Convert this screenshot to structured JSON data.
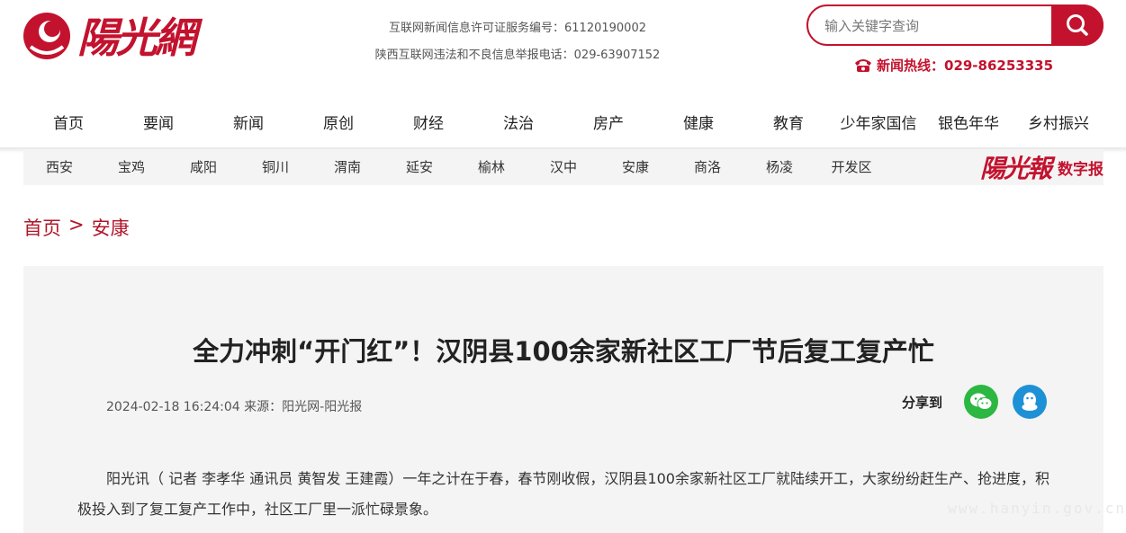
{
  "header": {
    "logo_text": "陽光網",
    "license_number": "互联网新闻信息许可证服务编号：61120190002",
    "report_phone": "陕西互联网违法和不良信息举报电话：029-63907152",
    "search_placeholder": "输入关键字查询",
    "hotline": "新闻热线：029-86253335"
  },
  "main_nav": [
    "首页",
    "要闻",
    "新闻",
    "原创",
    "财经",
    "法治",
    "房产",
    "健康",
    "教育",
    "少年家国信",
    "银色年华",
    "乡村振兴"
  ],
  "sub_nav": {
    "cities": [
      "西安",
      "宝鸡",
      "咸阳",
      "铜川",
      "渭南",
      "延安",
      "榆林",
      "汉中",
      "安康",
      "商洛",
      "杨凌",
      "开发区"
    ],
    "epaper_logo": "陽光報",
    "epaper_label": "数字报"
  },
  "breadcrumb": {
    "home": "首页",
    "separator": ">",
    "current": "安康"
  },
  "article": {
    "title": "全力冲刺“开门红”！汉阴县100余家新社区工厂节后复工复产忙",
    "datetime": "2024-02-18 16:24:04",
    "source": "来源：阳光网-阳光报",
    "share_label": "分享到",
    "body": "阳光讯（ 记者 李孝华 通讯员 黄智发 王建霞）一年之计在于春，春节刚收假，汉阴县100余家新社区工厂就陆续开工，大家纷纷赶生产、抢进度，积极投入到了复工复产工作中，社区工厂里一派忙碌景象。"
  },
  "watermark": "www.hanyin.gov.cn",
  "colors": {
    "brand_red": "#c3122e",
    "breadcrumb_red": "#b0162a",
    "wechat_green": "#2bb742",
    "qq_blue": "#1e91d6"
  }
}
